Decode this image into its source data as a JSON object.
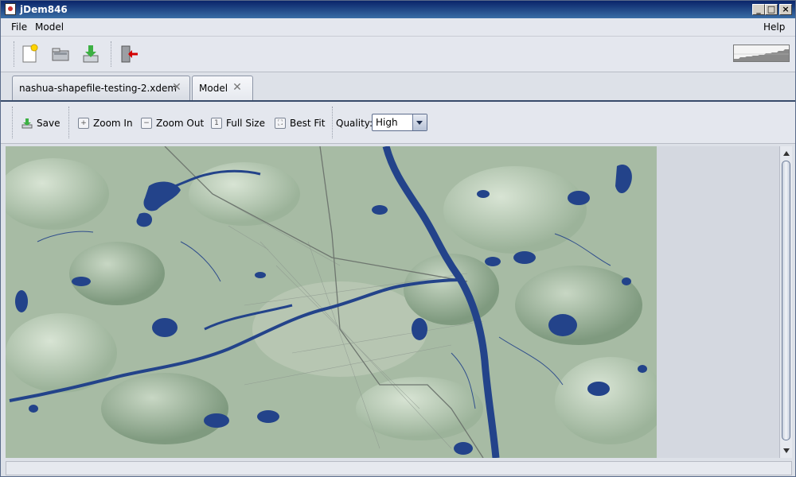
{
  "window": {
    "title": "jDem846"
  },
  "menus": {
    "file": "File",
    "model": "Model",
    "help": "Help"
  },
  "tabs": [
    {
      "label": "nashua-shapefile-testing-2.xdem"
    },
    {
      "label": "Model"
    }
  ],
  "model_toolbar": {
    "save": "Save",
    "zoom_in": "Zoom In",
    "zoom_out": "Zoom Out",
    "full_size": "Full Size",
    "best_fit": "Best Fit",
    "quality_label": "Quality:",
    "quality_value": "High"
  },
  "colors": {
    "water": "#23438a",
    "terrain": "#9db59a",
    "titlebar": "#0a246a"
  },
  "icons": [
    "new-file-icon",
    "open-folder-icon",
    "save-download-icon",
    "exit-icon"
  ]
}
